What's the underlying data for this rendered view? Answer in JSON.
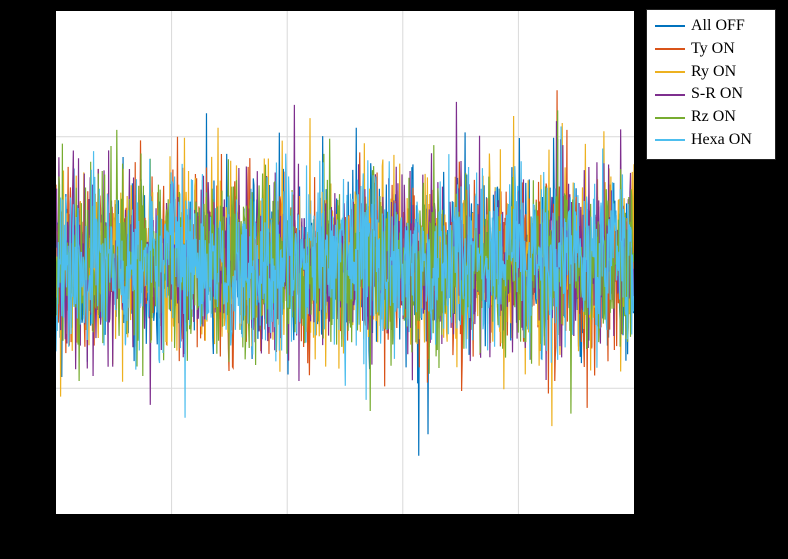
{
  "chart_data": {
    "type": "line",
    "title": "",
    "xlabel": "",
    "ylabel": "",
    "xlim": [
      0,
      1
    ],
    "ylim": [
      -1,
      1
    ],
    "grid": true,
    "yticks": [
      -1,
      -0.5,
      0,
      0.5,
      1
    ],
    "xticks": [
      0,
      0.2,
      0.4,
      0.6,
      0.8,
      1
    ],
    "note": "Dense noise-like time series; envelope roughly ±0.5 with occasional spikes to ±0.75. Individual sample values not readable.",
    "legend_position": "outside-right-top",
    "series": [
      {
        "name": "All OFF",
        "color": "#0072BD",
        "values": []
      },
      {
        "name": "Ty ON",
        "color": "#D95319",
        "values": []
      },
      {
        "name": "Ry ON",
        "color": "#EDB120",
        "values": []
      },
      {
        "name": "S-R ON",
        "color": "#7E2F8E",
        "values": []
      },
      {
        "name": "Rz ON",
        "color": "#77AC30",
        "values": []
      },
      {
        "name": "Hexa ON",
        "color": "#4DBEEE",
        "values": []
      }
    ]
  },
  "legend": {
    "items": [
      {
        "label": "All OFF",
        "color": "#0072BD"
      },
      {
        "label": "Ty ON",
        "color": "#D95319"
      },
      {
        "label": "Ry ON",
        "color": "#EDB120"
      },
      {
        "label": "S-R ON",
        "color": "#7E2F8E"
      },
      {
        "label": "Rz ON",
        "color": "#77AC30"
      },
      {
        "label": "Hexa ON",
        "color": "#4DBEEE"
      }
    ]
  }
}
